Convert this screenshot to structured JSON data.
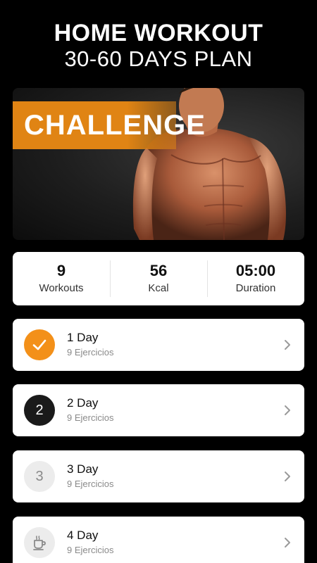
{
  "header": {
    "title": "HOME WORKOUT",
    "subtitle": "30-60 DAYS PLAN"
  },
  "hero": {
    "badge": "CHALLENGE",
    "accent_color": "#E08414"
  },
  "stats": [
    {
      "value": "9",
      "label": "Workouts"
    },
    {
      "value": "56",
      "label": "Kcal"
    },
    {
      "value": "05:00",
      "label": "Duration"
    }
  ],
  "days": [
    {
      "title": "1 Day",
      "subtitle": "9 Ejercicios",
      "icon": "check-icon",
      "status": "completed"
    },
    {
      "title": "2 Day",
      "subtitle": "9 Ejercicios",
      "number": "2",
      "status": "current"
    },
    {
      "title": "3 Day",
      "subtitle": "9 Ejercicios",
      "number": "3",
      "status": "locked"
    },
    {
      "title": "4 Day",
      "subtitle": "9 Ejercicios",
      "icon": "coffee-cup-icon",
      "status": "rest"
    }
  ],
  "colors": {
    "background": "#000000",
    "accent": "#F39019",
    "card": "#FFFFFF"
  }
}
